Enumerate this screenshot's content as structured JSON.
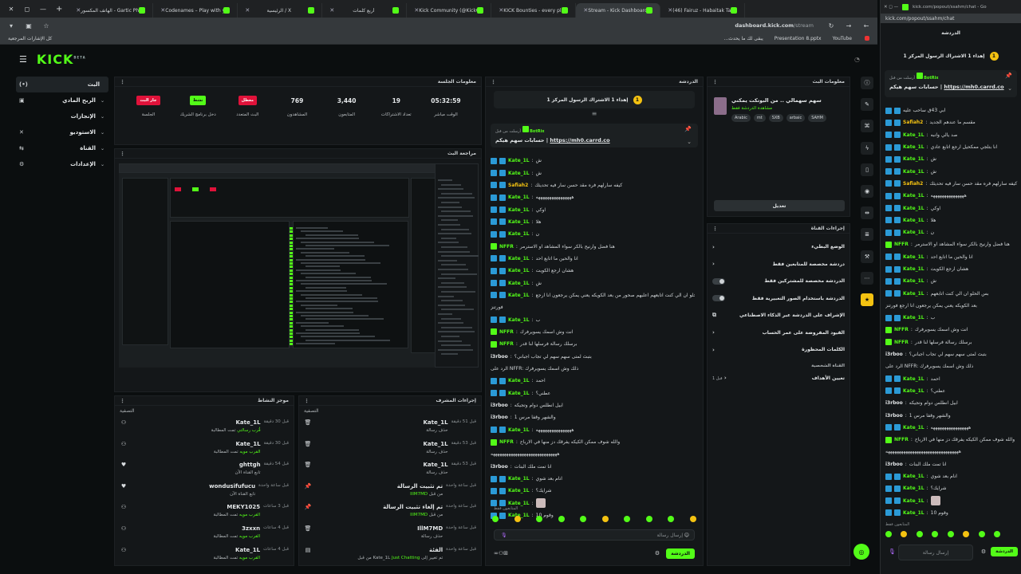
{
  "browser": {
    "tabs": [
      {
        "label": "الهاتف المكسور - Gartic Phone",
        "active": false
      },
      {
        "label": "Codenames – Play with your Fr",
        "active": false
      },
      {
        "label": "الرئيسية / X",
        "active": false
      },
      {
        "label": "أربع كلمات",
        "active": false
      },
      {
        "label": "Kick Community (@KickCommu",
        "active": false
      },
      {
        "label": "KICK Bounties - every player fo",
        "active": false
      },
      {
        "label": "Stream - Kick Dashboard",
        "active": true
      },
      {
        "label": "(46) Fairuz - Habaitak Ta Neser",
        "active": false
      }
    ],
    "url_host": "dashboard.kick.com",
    "url_path": "/stream",
    "bookmarks_left": "كل الإشارات المرجعية",
    "bookmarks_right": [
      "...يبقى لك ما يحدث",
      "Presentation 8.pptx",
      "YouTube"
    ]
  },
  "kick": {
    "logo": "KICK",
    "nav": [
      {
        "label": "البث",
        "icon": "(•)",
        "active": true
      },
      {
        "label": "الربح المادي",
        "icon": "▣",
        "active": false
      },
      {
        "label": "الإنجازات",
        "icon": "",
        "active": false
      },
      {
        "label": "الاستوديو",
        "icon": "✕",
        "active": false
      },
      {
        "label": "القناة",
        "icon": "⇆",
        "active": false
      },
      {
        "label": "الإعدادات",
        "icon": "⚙",
        "active": false
      }
    ],
    "session": {
      "title": "معلومات الجلسة",
      "stats": [
        {
          "value": "جار البث",
          "label": "الجلسة",
          "badge": "red"
        },
        {
          "value": "نشط",
          "label": "دخل برنامج الشريك",
          "badge": "green"
        },
        {
          "value": "معطل",
          "label": "البث المتعدد",
          "badge": "red"
        },
        {
          "value": "769",
          "label": "المشاهدون"
        },
        {
          "value": "3,440",
          "label": "المتابعون"
        },
        {
          "value": "19",
          "label": "تعداد الاشتراكات"
        },
        {
          "value": "05:32:59",
          "label": "الوقت مباشر"
        }
      ]
    },
    "preview_title": "مراجعة البث",
    "activity": {
      "title": "موجز النشاط",
      "filter": "التصفية",
      "items": [
        {
          "icon": "person",
          "name": "Kate_1L",
          "sub": "تمت المطالبة",
          "sub_hl": "قُرب رسالتي",
          "time": "قبل 30 دقيقة"
        },
        {
          "icon": "person",
          "name": "Kate_1L",
          "sub": "تمت المطالبة",
          "sub_hl": "القرب مويه",
          "time": "قبل 30 دقيقة"
        },
        {
          "icon": "heart",
          "name": "ghttgh",
          "sub": "تابع القناة الآن",
          "sub_hl": "",
          "time": "قبل 54 دقيقة"
        },
        {
          "icon": "heart",
          "name": "wondusifufucu",
          "sub": "تابع القناة الآن",
          "sub_hl": "",
          "time": "قبل ساعة واحدة"
        },
        {
          "icon": "person",
          "name": "MEKY1025",
          "sub": "تمت المطالبة",
          "sub_hl": "القرب مويه",
          "time": "قبل 3 ساعات"
        },
        {
          "icon": "person",
          "name": "3zxxn",
          "sub": "تمت المطالبة",
          "sub_hl": "القرب مويه",
          "time": "قبل 4 ساعات"
        },
        {
          "icon": "person",
          "name": "Kate_1L",
          "sub": "تمت المطالبة",
          "sub_hl": "القرب مويه",
          "time": "قبل 4 ساعات"
        }
      ]
    },
    "modactions": {
      "title": "إجراءات المشرف",
      "filter": "التصفية",
      "items": [
        {
          "icon": "trash",
          "name": "Kate_1L",
          "sub": "حذف رسالة",
          "time": "قبل 51 دقيقة"
        },
        {
          "icon": "trash",
          "name": "Kate_1L",
          "sub": "حذف رسالة",
          "time": "قبل 53 دقيقة"
        },
        {
          "icon": "trash",
          "name": "Kate_1L",
          "sub": "حذف رسالة",
          "time": "قبل 53 دقيقة"
        },
        {
          "icon": "pin",
          "name": "تم تثبيت الرسالة",
          "sub": "من قبل",
          "sub_hl": "IllM7MD",
          "time": "قبل ساعة واحدة"
        },
        {
          "icon": "pin",
          "name": "تم إلغاء تثبيت الرسالة",
          "sub": "من قبل",
          "sub_hl": "IllM7MD",
          "time": "قبل ساعة واحدة"
        },
        {
          "icon": "trash",
          "name": "IllM7MD",
          "sub": "حذف رسالة",
          "time": "قبل ساعة واحدة"
        },
        {
          "icon": "cal",
          "name": "الفئة",
          "sub": "تم تغيير إلى",
          "sub_hl": "Just Chatting",
          "sub_tail": "من قبل Kate_1L",
          "time": "قبل ساعة واحدة"
        }
      ]
    },
    "chat": {
      "title": "الدردشة",
      "pinned": "إهداء 1 الاشتراك الرسول المركز 1",
      "coin": "1",
      "pinbox_head": "أرسلت من قبل",
      "pinbox_user": "BotRix",
      "pinbox_line": "حسابات سهم هيكم",
      "pinbox_link": "https://mh0.carrd.co",
      "messages": [
        {
          "u": "Kate_1L",
          "t": "ش",
          "c": "g",
          "b": 2
        },
        {
          "u": "Kate_1L",
          "t": "ش",
          "c": "g",
          "b": 2
        },
        {
          "u": "Safiah2",
          "t": "كيفه سارلهم فره مقد حسن سار فيه تحديثك",
          "c": "y",
          "b": 2
        },
        {
          "u": "Kate_1L",
          "t": "ههههههههههههههههه",
          "c": "g",
          "b": 2
        },
        {
          "u": "Kate_1L",
          "t": "اوكي",
          "c": "g",
          "b": 2
        },
        {
          "u": "Kate_1L",
          "t": "هلا",
          "c": "g",
          "b": 2
        },
        {
          "u": "Kate_1L",
          "t": "ن",
          "c": "g",
          "b": 2
        },
        {
          "u": "NFFR",
          "t": "هنا فضل وارنيح بالكر سواء المشاهد او الاسترمر",
          "c": "g",
          "b": 1
        },
        {
          "u": "Kate_1L",
          "t": "انا والحين ما اتابع احد",
          "c": "g",
          "b": 2
        },
        {
          "u": "Kate_1L",
          "t": "هشان ارجع الكويت",
          "c": "g",
          "b": 2
        },
        {
          "u": "Kate_1L",
          "t": "ش",
          "c": "g",
          "b": 2
        },
        {
          "u": "Kate_1L",
          "t": "بس الحلو ان الي كنت اتابعهم اعلبهم صحور من بعد الكويكه يعني يمكن يرجعون انا ارجع",
          "c": "g",
          "b": 2
        },
        {
          "u": "",
          "t": "فورتنز",
          "c": "w",
          "b": 0
        },
        {
          "u": "Kate_1L",
          "t": "ب",
          "c": "g",
          "b": 2
        },
        {
          "u": "NFFR",
          "t": "انت وش اسمك يسويرفرك",
          "c": "g",
          "b": 1
        },
        {
          "u": "NFFR",
          "t": "برسلك رسالة فرسلها لنا قدر",
          "c": "g",
          "b": 1
        },
        {
          "u": "i3rboo",
          "t": "بتبث لمتى سهم سهم لي تجاب اجباني؟",
          "c": "w",
          "b": 0
        },
        {
          "u": "",
          "t": "الرد على NFFR: ذلك وش اسمك يسويرفرك",
          "c": "w",
          "b": 0
        },
        {
          "u": "Kate_1L",
          "t": "احمد",
          "c": "g",
          "b": 2
        },
        {
          "u": "Kate_1L",
          "t": "عطني؟",
          "c": "g",
          "b": 2
        },
        {
          "u": "i3rboo",
          "t": "ابيل انطلس دوام وتجيكه",
          "c": "w",
          "b": 0
        },
        {
          "u": "i3rboo",
          "t": "والشهر وقفا مرس 1",
          "c": "w",
          "b": 0
        },
        {
          "u": "Kate_1L",
          "t": "ههههههههههههههههه",
          "c": "g",
          "b": 2
        },
        {
          "u": "NFFR",
          "t": "والله شوف ممكن الكيكه يفرقك دز منها في الارباح",
          "c": "g",
          "b": 1
        },
        {
          "u": "",
          "t": "ههههههههههههههههههههههههههههههه",
          "c": "w",
          "b": 0
        },
        {
          "u": "i3rboo",
          "t": "انا تمت ملك البنات",
          "c": "w",
          "b": 0
        },
        {
          "u": "Kate_1L",
          "t": "انام بعد شوي",
          "c": "g",
          "b": 2
        },
        {
          "u": "Kate_1L",
          "t": "شرايك؟",
          "c": "g",
          "b": 2
        },
        {
          "u": "Kate_1L",
          "t": "",
          "c": "g",
          "b": 2,
          "img": true
        },
        {
          "u": "Kate_1L",
          "t": "وقوم 10",
          "c": "g",
          "b": 2
        }
      ],
      "followers_only": "المتابعون فقط",
      "input_placeholder": "إرسال رسالة",
      "send": "الدردشة"
    },
    "streaminfo": {
      "title": "معلومات البث",
      "name": "سهم سهمالي .. من البوتكت يمكني",
      "category": "مشاهدة الدردشة فقط",
      "tags": [
        "Arabic",
        "mt",
        "SXB",
        "arbaic",
        "SAHM"
      ],
      "edit": "تعديل"
    },
    "chanactions": {
      "title": "إجراءات القناة",
      "rows": [
        {
          "label": "الوضع البطيء",
          "kind": "arrow"
        },
        {
          "label": "دردشة مخصصة للمتابعين فقط",
          "kind": "arrow"
        },
        {
          "label": "الدردشة مخصصة للمشتركين فقط",
          "kind": "toggle"
        },
        {
          "label": "الدردشة باستخدام الصور التعبيرية فقط",
          "kind": "toggle"
        },
        {
          "label": "الإشراف على الدردشة عبر الذكاء الاصطناعي",
          "kind": "ext"
        },
        {
          "label": "القيود المفروضة على عمر الحساب",
          "kind": "arrow"
        },
        {
          "label": "الكلمات المحظورة",
          "kind": "arrow"
        }
      ],
      "section": "القناة الشخصية",
      "goal_label": "تعيين الأهداف",
      "goal_value": "قبل 1"
    }
  },
  "popout": {
    "tab_label": "kick.com/popout/ssahm/chat - Go",
    "url": "kick.com/popout/ssahm/chat",
    "title": "الدردشة",
    "pinned": "إهداء 1 الاشتراك الرسول المركز 1",
    "coin": "1",
    "pinbox_head": "أرسلت من قبل",
    "pinbox_user": "BotRix",
    "pinbox_line": "حسابات سهم هيكم",
    "pinbox_link": "https://mh0.carrd.co",
    "messages": [
      {
        "u": "",
        "t": "ابي 43ق ساحب عليه",
        "c": "w",
        "b": 2
      },
      {
        "u": "Safiah2",
        "t": "مقسم ما عندهم الجديد",
        "c": "y",
        "b": 2
      },
      {
        "u": "Kate_1L",
        "t": "صد يالي وانبه",
        "c": "g",
        "b": 2
      },
      {
        "u": "Kate_1L",
        "t": "انا بتلجي ممكحيل ارجع اتابع عادي",
        "c": "g",
        "b": 2
      },
      {
        "u": "Kate_1L",
        "t": "ش",
        "c": "g",
        "b": 2
      },
      {
        "u": "Kate_1L",
        "t": "ش",
        "c": "g",
        "b": 2
      },
      {
        "u": "Safiah2",
        "t": "كيفه سارلهم فره مقد حسن سار فيه تحديثك",
        "c": "y",
        "b": 2
      },
      {
        "u": "Kate_1L",
        "t": "هههههههههههههههه",
        "c": "g",
        "b": 2
      },
      {
        "u": "Kate_1L",
        "t": "اوكي",
        "c": "g",
        "b": 2
      },
      {
        "u": "Kate_1L",
        "t": "هلا",
        "c": "g",
        "b": 2
      },
      {
        "u": "Kate_1L",
        "t": "ن",
        "c": "g",
        "b": 2
      },
      {
        "u": "NFFR",
        "t": "هنا فضل وارنيح بالكر سواء المشاهد او الاسترمر",
        "c": "g",
        "b": 1
      },
      {
        "u": "Kate_1L",
        "t": "انا والحين ما اتابع احد",
        "c": "g",
        "b": 2
      },
      {
        "u": "Kate_1L",
        "t": "هشان ارجع الكويت",
        "c": "g",
        "b": 2
      },
      {
        "u": "Kate_1L",
        "t": "ش",
        "c": "g",
        "b": 2
      },
      {
        "u": "Kate_1L",
        "t": "بس الحلو ان الي كنت اتابعهم",
        "c": "g",
        "b": 2
      },
      {
        "u": "",
        "t": "بعد الكويكه يعني يمكن يرجعون انا ارجع فورتنز",
        "c": "w",
        "b": 0
      },
      {
        "u": "Kate_1L",
        "t": "ب",
        "c": "g",
        "b": 2
      },
      {
        "u": "NFFR",
        "t": "انت وش اسمك يسويرفرك",
        "c": "g",
        "b": 1
      },
      {
        "u": "NFFR",
        "t": "برسلك رسالة فرسلها لنا قدر",
        "c": "g",
        "b": 1
      },
      {
        "u": "i3rboo",
        "t": "بتبث لمتى سهم سهم لي تجاب اجباني؟",
        "c": "w",
        "b": 0
      },
      {
        "u": "",
        "t": "الرد على NFFR: ذلك وش اسمك يسويرفرك",
        "c": "w",
        "b": 0
      },
      {
        "u": "Kate_1L",
        "t": "احمد",
        "c": "g",
        "b": 2
      },
      {
        "u": "Kate_1L",
        "t": "عطني؟",
        "c": "g",
        "b": 2
      },
      {
        "u": "i3rboo",
        "t": "ابيل انطلس دوام وتجيكه",
        "c": "w",
        "b": 0
      },
      {
        "u": "i3rboo",
        "t": "والشهر وقفا مرس 1",
        "c": "w",
        "b": 0
      },
      {
        "u": "Kate_1L",
        "t": "هههههههههههههههههه",
        "c": "g",
        "b": 2
      },
      {
        "u": "NFFR",
        "t": "والله شوف ممكن الكيكه يفرقك دز منها في الارباح",
        "c": "g",
        "b": 1
      },
      {
        "u": "",
        "t": "هههههههههههههههههههههههههههههههههه",
        "c": "w",
        "b": 0
      },
      {
        "u": "i3rboo",
        "t": "انا تمت ملك البنات",
        "c": "w",
        "b": 0
      },
      {
        "u": "Kate_1L",
        "t": "انام بعد شوي",
        "c": "g",
        "b": 2
      },
      {
        "u": "Kate_1L",
        "t": "شرايك؟",
        "c": "g",
        "b": 2
      },
      {
        "u": "Kate_1L",
        "t": "",
        "c": "g",
        "b": 2,
        "img": true
      },
      {
        "u": "Kate_1L",
        "t": "وقوم 10",
        "c": "g",
        "b": 2
      }
    ],
    "followers_only": "المتابعون فقط",
    "input_placeholder": "إرسال رسالة",
    "send": "الدردشة"
  },
  "colors": {
    "accent": "#53fc18",
    "bg": "#0b0e0f",
    "panel": "#141719",
    "gold": "#f4c211",
    "live": "#e0123a"
  }
}
